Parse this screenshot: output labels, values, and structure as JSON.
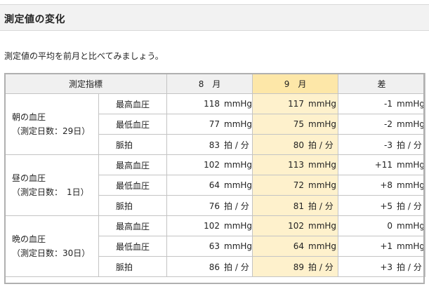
{
  "header": {
    "title": "測定値の変化"
  },
  "intro": "測定値の平均を前月と比べてみましょう。",
  "table": {
    "columns": {
      "metric": "測定指標",
      "aug": "8　月",
      "sep": "9　月",
      "diff": "差"
    },
    "highlight_color": "#fde7a8",
    "groups": [
      {
        "name": "朝の血圧",
        "days": "（測定日数：29日）",
        "rows": [
          {
            "metric": "最高血圧",
            "aug": "118",
            "aug_unit": "mmHg",
            "sep": "117",
            "sep_unit": "mmHg",
            "diff": "-1",
            "diff_unit": "mmHg"
          },
          {
            "metric": "最低血圧",
            "aug": "77",
            "aug_unit": "mmHg",
            "sep": "75",
            "sep_unit": "mmHg",
            "diff": "-2",
            "diff_unit": "mmHg"
          },
          {
            "metric": "脈拍",
            "aug": "83",
            "aug_unit": "拍 / 分",
            "sep": "80",
            "sep_unit": "拍 / 分",
            "diff": "-3",
            "diff_unit": "拍 / 分"
          }
        ]
      },
      {
        "name": "昼の血圧",
        "days": "（測定日数：　1日）",
        "rows": [
          {
            "metric": "最高血圧",
            "aug": "102",
            "aug_unit": "mmHg",
            "sep": "113",
            "sep_unit": "mmHg",
            "diff": "+11",
            "diff_unit": "mmHg"
          },
          {
            "metric": "最低血圧",
            "aug": "64",
            "aug_unit": "mmHg",
            "sep": "72",
            "sep_unit": "mmHg",
            "diff": "+8",
            "diff_unit": "mmHg"
          },
          {
            "metric": "脈拍",
            "aug": "76",
            "aug_unit": "拍 / 分",
            "sep": "81",
            "sep_unit": "拍 / 分",
            "diff": "+5",
            "diff_unit": "拍 / 分"
          }
        ]
      },
      {
        "name": "晩の血圧",
        "days": "（測定日数：30日）",
        "rows": [
          {
            "metric": "最高血圧",
            "aug": "102",
            "aug_unit": "mmHg",
            "sep": "102",
            "sep_unit": "mmHg",
            "diff": "0",
            "diff_unit": "mmHg"
          },
          {
            "metric": "最低血圧",
            "aug": "63",
            "aug_unit": "mmHg",
            "sep": "64",
            "sep_unit": "mmHg",
            "diff": "+1",
            "diff_unit": "mmHg"
          },
          {
            "metric": "脈拍",
            "aug": "86",
            "aug_unit": "拍 / 分",
            "sep": "89",
            "sep_unit": "拍 / 分",
            "diff": "+3",
            "diff_unit": "拍 / 分"
          }
        ]
      }
    ]
  }
}
